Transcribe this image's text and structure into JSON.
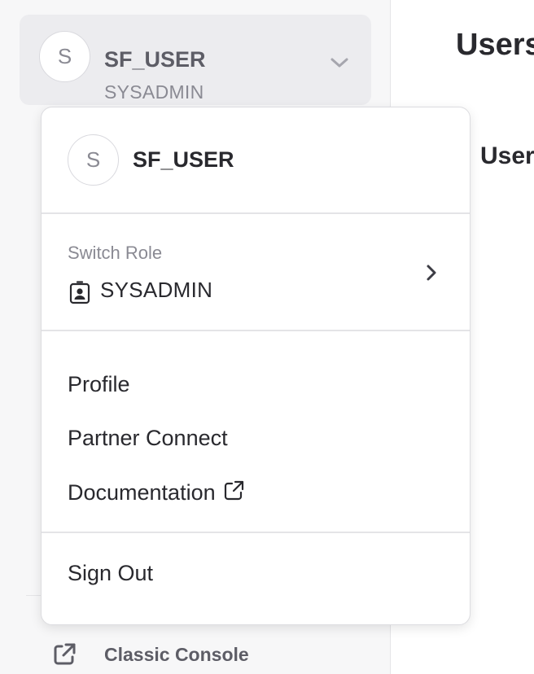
{
  "user_switcher": {
    "avatar_initial": "S",
    "username": "SF_USER",
    "role": "SYSADMIN"
  },
  "main": {
    "title": "Users",
    "tab_label": "Users"
  },
  "dropdown": {
    "avatar_initial": "S",
    "username": "SF_USER",
    "switch_role_label": "Switch Role",
    "current_role": "SYSADMIN",
    "menu_items": [
      "Profile",
      "Partner Connect",
      "Documentation"
    ],
    "sign_out": "Sign Out"
  },
  "sidebar": {
    "classic_console_label": "Classic Console"
  },
  "icons": {
    "user_switcher_chevron": "chevron-down-icon",
    "switch_role_chevron": "chevron-right-icon",
    "role_badge": "id-badge-icon",
    "external_link": "external-link-icon"
  },
  "colors": {
    "sidebar_bg": "#f7f7f8",
    "switcher_bg": "#ececef",
    "text_primary": "#29292e",
    "text_muted": "#8a8a93"
  }
}
